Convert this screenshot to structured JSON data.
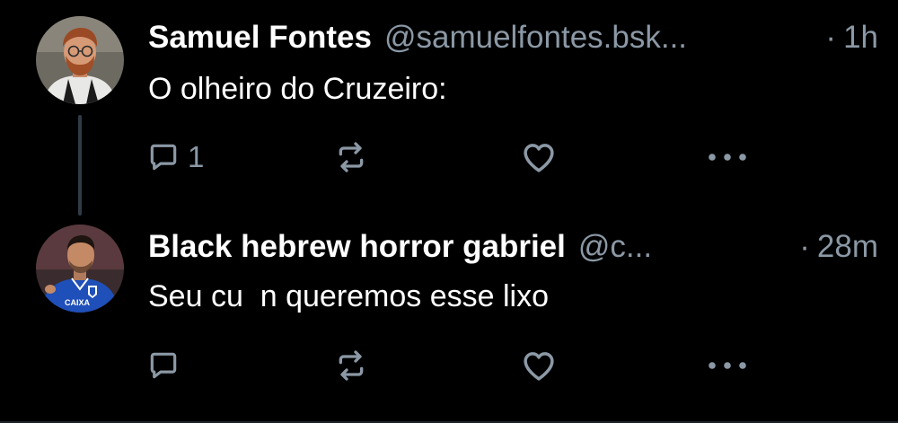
{
  "posts": [
    {
      "display_name": "Samuel Fontes",
      "handle": "@samuelfontes.bsk...",
      "time": "1h",
      "separator": "·",
      "text": "O olheiro do Cruzeiro:",
      "reply_count": "1",
      "avatar_icon": "person-avatar-white-shirt",
      "has_thread_line": true
    },
    {
      "display_name": "Black hebrew horror gabriel",
      "handle": "@c...",
      "time": "28m",
      "separator": "·",
      "text": "Seu cu  n queremos esse lixo",
      "reply_count": "",
      "avatar_icon": "person-avatar-blue-jersey",
      "has_thread_line": false
    }
  ],
  "avatar_badge_text": "CAIXA",
  "colors": {
    "background": "#000000",
    "text_primary": "#ffffff",
    "text_secondary": "#8b98a5",
    "thread_line": "#2f3b47",
    "jersey_blue": "#1f4fb8"
  },
  "icons": {
    "reply": "reply-icon",
    "repost": "repost-icon",
    "like": "heart-icon",
    "more": "more-options-icon"
  }
}
